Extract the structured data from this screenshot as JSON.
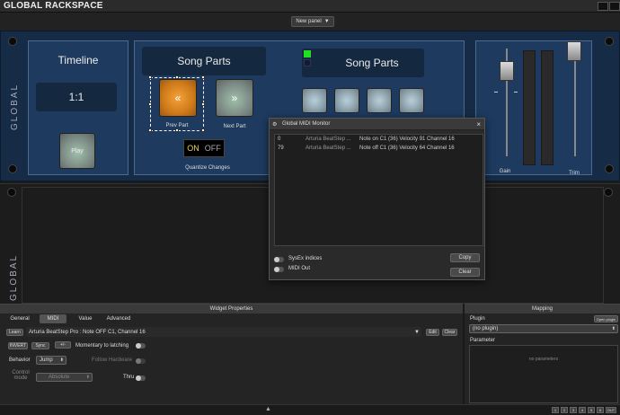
{
  "title": "GLOBAL RACKSPACE",
  "panel_select": "New panel",
  "rack": {
    "side_label": "GLOBAL",
    "timeline": {
      "title": "Timeline",
      "position": "1:1",
      "play_label": "Play"
    },
    "song_parts": {
      "title": "Song Parts",
      "prev_glyph": "«",
      "prev_label": "Prev Part",
      "next_glyph": "»",
      "next_label": "Next Part",
      "switch_on": "ON",
      "switch_off": "OFF",
      "quantize_label": "Quantize Changes"
    },
    "song_parts_2": {
      "title": "Song Parts"
    },
    "gain_label": "Gain",
    "trim_label": "Trim"
  },
  "rack2": {
    "side_label": "GLOBAL"
  },
  "midi_monitor": {
    "title": "Global MIDI Monitor",
    "rows": [
      {
        "num": "0",
        "device": "Arturia BeatStep ...",
        "message": "Note on C1 (36) Velocity 91 Channel 16"
      },
      {
        "num": "79",
        "device": "Arturia BeatStep ...",
        "message": "Note off C1 (36) Velocity 64 Channel 16"
      }
    ],
    "sysex_label": "SysEx indices",
    "midiout_label": "MIDI Out",
    "copy_label": "Copy",
    "clear_label": "Clear"
  },
  "props": {
    "title": "Widget Properties",
    "tabs": [
      "General",
      "MIDI",
      "Value",
      "Advanced"
    ],
    "active_tab": "MIDI",
    "learn_label": "Learn",
    "midi_source": "Arturia BeatStep Pro : Note OFF C1, Channel 16",
    "edit_label": "Edit",
    "clear_label": "Clear",
    "invert_label": "INVERT",
    "sync_label": "Sync",
    "pm_label": "+/-",
    "momentary_label": "Momentary to latching",
    "behavior_label": "Behavior",
    "behavior_value": "Jump",
    "follow_hw_label": "Follow Hardware",
    "control_mode_label": "Control mode",
    "control_mode_value": "Absolute",
    "thru_label": "Thru"
  },
  "mapping": {
    "title": "Mapping",
    "plugin_label": "Plugin",
    "open_plugin_label": "Open plugin",
    "plugin_value": "(no plugin)",
    "parameter_label": "Parameter",
    "no_params": "no parameters"
  },
  "footer": {
    "pages": [
      "1",
      "2",
      "3",
      "4",
      "5",
      "6",
      "OUT"
    ]
  },
  "colors": {
    "accent_orange": "#e08a22",
    "rack_blue": "#162b45",
    "led_green": "#22dd22"
  }
}
